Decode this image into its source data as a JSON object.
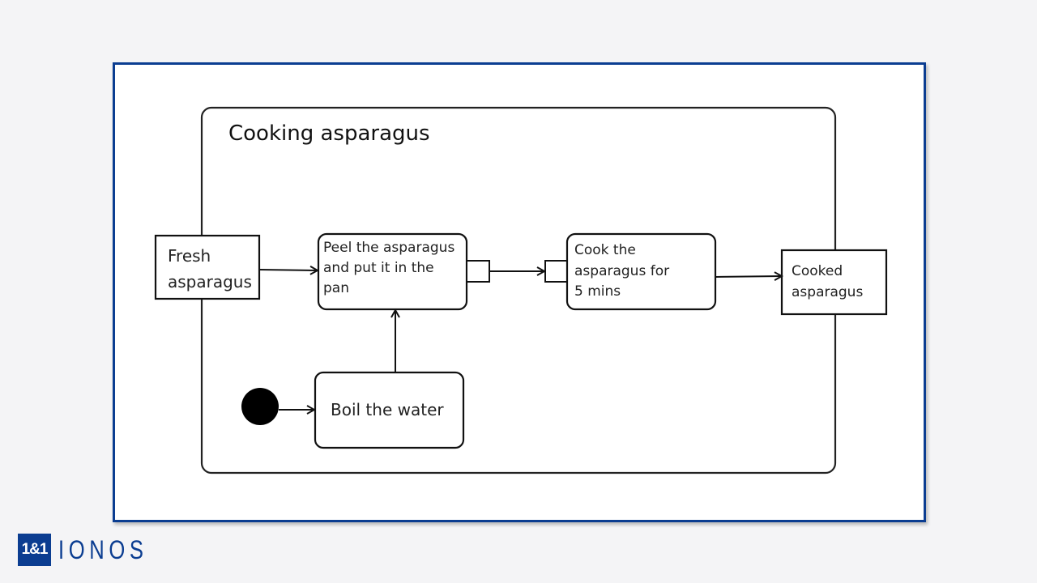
{
  "diagram": {
    "title": "Cooking asparagus",
    "objects": {
      "fresh": [
        "Fresh",
        "asparagus"
      ],
      "cooked": [
        "Cooked",
        "asparagus"
      ]
    },
    "actions": {
      "peel": [
        "Peel the asparagus",
        "and put it in the",
        "pan"
      ],
      "cook": [
        "Cook the",
        "asparagus for",
        "5 mins"
      ],
      "boil": "Boil the water"
    },
    "edges": [
      {
        "from": "fresh",
        "to": "peel"
      },
      {
        "from": "boil",
        "to": "peel"
      },
      {
        "from": "peel-output-pin",
        "to": "cook-input-pin"
      },
      {
        "from": "cook",
        "to": "cooked"
      },
      {
        "from": "initial-node",
        "to": "boil"
      }
    ]
  },
  "brand": {
    "box": "1&1",
    "name": "IONOS",
    "color": "#0b3d91"
  }
}
